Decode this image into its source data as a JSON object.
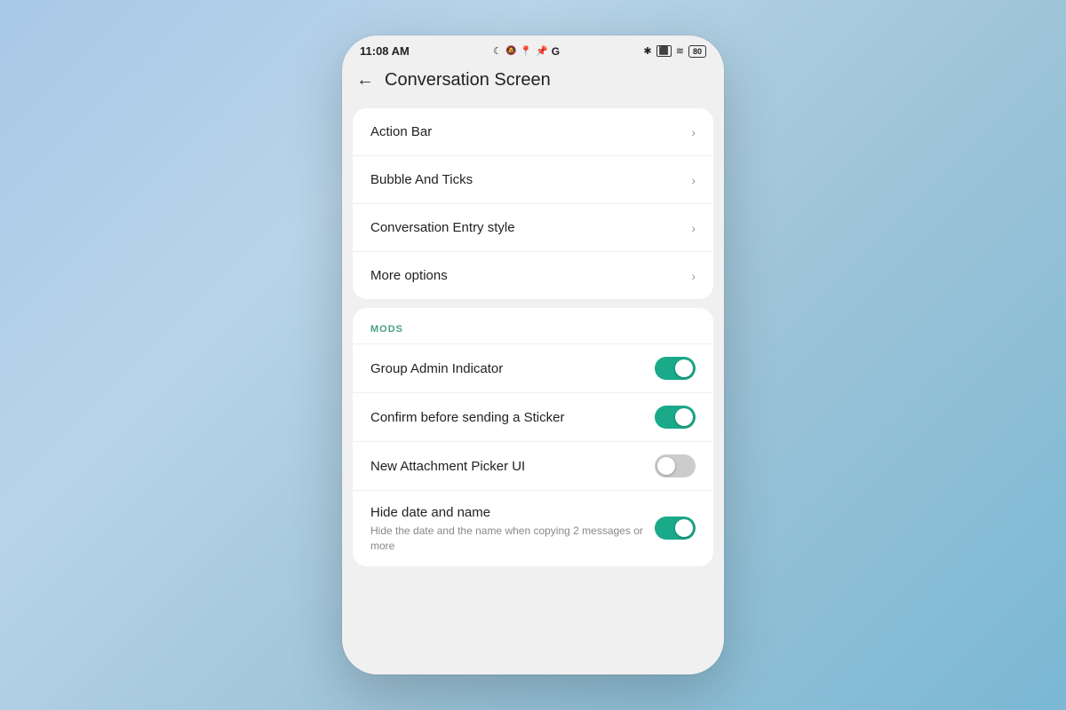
{
  "statusBar": {
    "time": "11:08 AM",
    "icons": "☾ 🔕 📍 📌 G",
    "rightIcons": "* ⬛ ≈ 80"
  },
  "header": {
    "backLabel": "←",
    "title": "Conversation Screen"
  },
  "menuCard": {
    "items": [
      {
        "label": "Action Bar"
      },
      {
        "label": "Bubble And Ticks"
      },
      {
        "label": "Conversation Entry style"
      },
      {
        "label": "More options"
      }
    ]
  },
  "modsSection": {
    "sectionLabel": "MODS",
    "items": [
      {
        "label": "Group Admin Indicator",
        "sublabel": "",
        "state": "on"
      },
      {
        "label": "Confirm before sending a Sticker",
        "sublabel": "",
        "state": "on"
      },
      {
        "label": "New Attachment Picker UI",
        "sublabel": "",
        "state": "off"
      },
      {
        "label": "Hide date and name",
        "sublabel": "Hide the date and the name when copying 2 messages or more",
        "state": "on"
      }
    ]
  }
}
